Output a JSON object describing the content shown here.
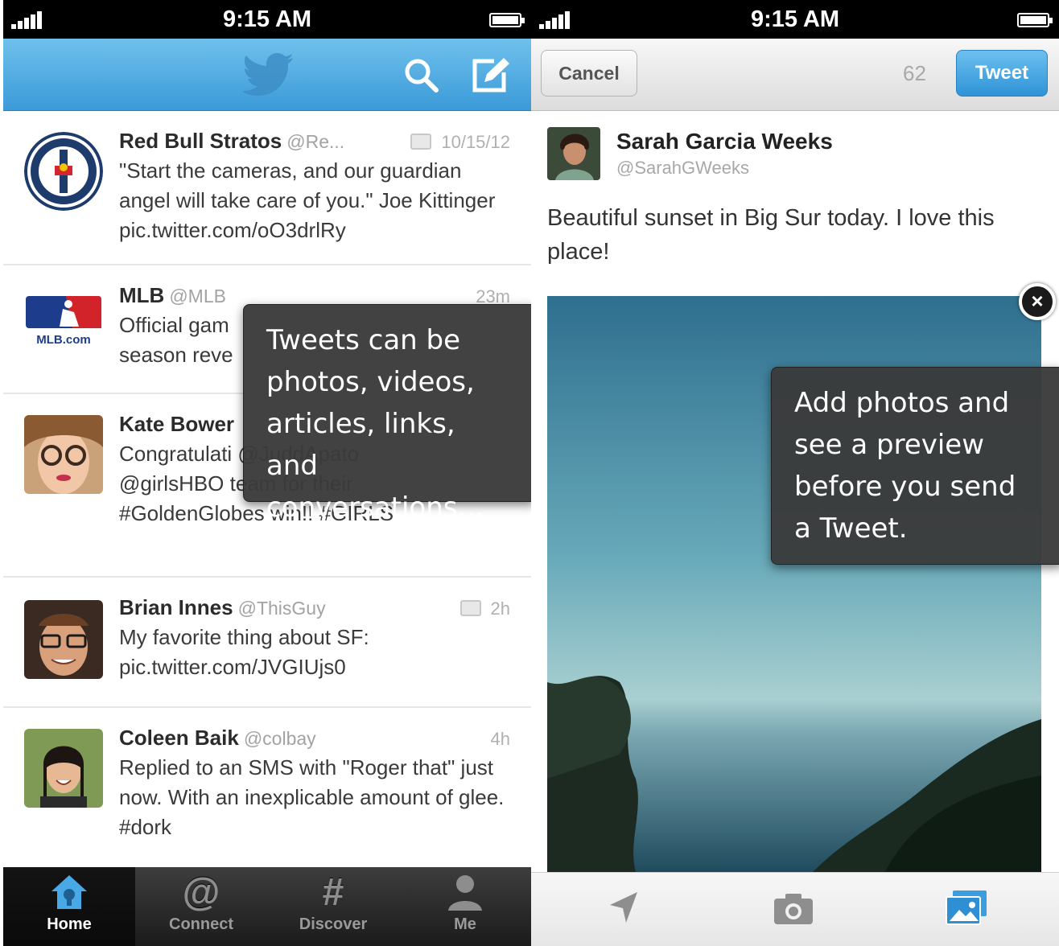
{
  "left_screen": {
    "status_bar": {
      "time": "9:15 AM"
    },
    "tweets": [
      {
        "name": "Red Bull Stratos",
        "handle": "@Re...",
        "time": "10/15/12",
        "has_media": true,
        "text": "\"Start the cameras, and our guardian angel will take care of you.\" Joe Kittinger pic.twitter.com/oO3drlRy"
      },
      {
        "name": "MLB",
        "handle": "@MLB",
        "time": "23m",
        "has_media": false,
        "text": "Official gam season reve"
      },
      {
        "name": "Kate Bower",
        "handle": "",
        "time": "",
        "has_media": false,
        "text": "Congratulati @JuddApato @girlsHBO team for their #GoldenGlobes win!! #GIRLS"
      },
      {
        "name": "Brian Innes",
        "handle": "@ThisGuy",
        "time": "2h",
        "has_media": true,
        "text": "My favorite thing about SF: pic.twitter.com/JVGIUjs0"
      },
      {
        "name": "Coleen Baik",
        "handle": "@colbay",
        "time": "4h",
        "has_media": false,
        "text": "Replied to an SMS with \"Roger that\" just now. With an inexplicable amount of glee. #dork"
      }
    ],
    "avatar_labels": {
      "mlb": "MLB.com"
    },
    "tooltip": "Tweets can be photos, videos, articles, links, and conversations...",
    "tabs": [
      {
        "label": "Home",
        "glyph": "",
        "icon": "home-icon",
        "active": true
      },
      {
        "label": "Connect",
        "glyph": "@",
        "icon": "at-icon",
        "active": false
      },
      {
        "label": "Discover",
        "glyph": "#",
        "icon": "hash-icon",
        "active": false
      },
      {
        "label": "Me",
        "glyph": "",
        "icon": "person-icon",
        "active": false
      }
    ],
    "colors": {
      "nav_blue": "#4aa8e0",
      "tab_bar": "#2a2a2a"
    }
  },
  "right_screen": {
    "status_bar": {
      "time": "9:15 AM"
    },
    "cancel_label": "Cancel",
    "char_count": "62",
    "tweet_label": "Tweet",
    "author_name": "Sarah Garcia Weeks",
    "author_handle": "@SarahGWeeks",
    "compose_text": "Beautiful sunset in Big Sur today. I love this place!",
    "tooltip": "Add photos and see a preview before you send a Tweet.",
    "toolbar_icons": [
      "location-arrow-icon",
      "camera-icon",
      "photos-icon"
    ],
    "colors": {
      "tweet_button": "#3fa3e2",
      "photos_icon_active": "#3a9ee0"
    }
  }
}
